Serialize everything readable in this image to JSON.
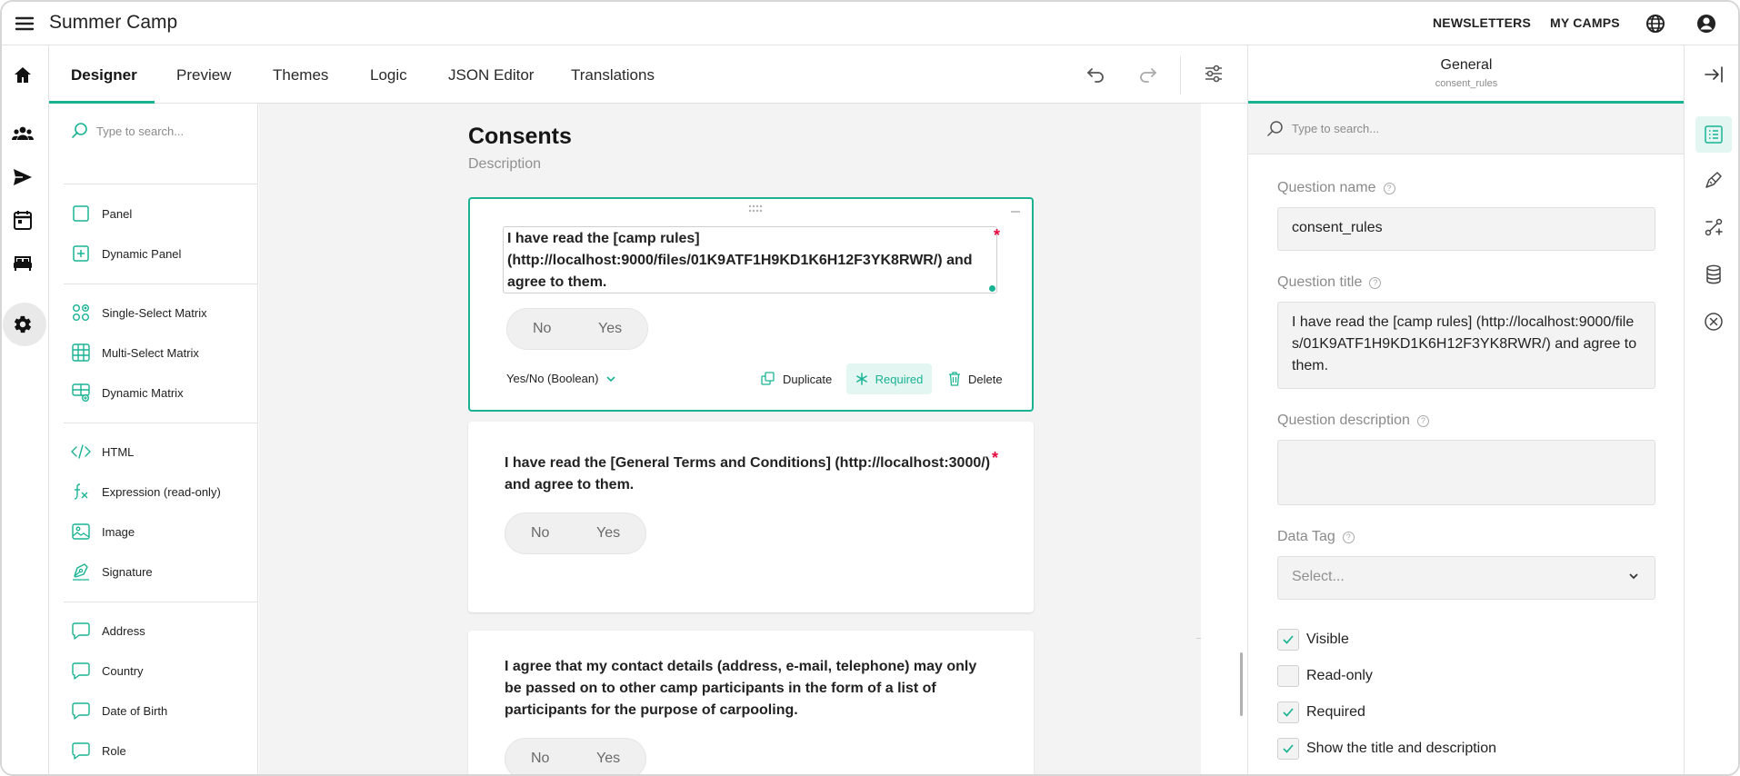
{
  "app": {
    "title": "Summer Camp",
    "links": [
      "NEWSLETTERS",
      "MY CAMPS"
    ],
    "icons": [
      "menu-icon",
      "globe-icon",
      "account-icon"
    ]
  },
  "rail": {
    "icons": [
      "home-icon",
      "people-icon",
      "send-icon",
      "calendar-icon",
      "bed-icon",
      "gear-icon"
    ],
    "selected": "gear-icon"
  },
  "tabs": {
    "items": [
      "Designer",
      "Preview",
      "Themes",
      "Logic",
      "JSON Editor",
      "Translations"
    ],
    "active": "Designer",
    "tools": [
      "undo-icon",
      "redo-icon",
      "settings-sliders-icon"
    ]
  },
  "toolbox": {
    "search_placeholder": "Type to search...",
    "items": [
      "Panel",
      "Dynamic Panel",
      "Single-Select Matrix",
      "Multi-Select Matrix",
      "Dynamic Matrix",
      "HTML",
      "Expression (read-only)",
      "Image",
      "Signature",
      "Address",
      "Country",
      "Date of Birth",
      "Role"
    ]
  },
  "survey": {
    "page_title": "Consents",
    "page_description": "Description",
    "questions": [
      {
        "title": "I have read the [camp rules] (http://localhost:9000/files/01K9ATF1H9KD1K6H12F3YK8RWR/) and agree to them.",
        "required_mark": "*",
        "no": "No",
        "yes": "Yes",
        "type_label": "Yes/No (Boolean)",
        "actions": [
          "Duplicate",
          "Required",
          "Delete"
        ]
      },
      {
        "title": "I have read the [General Terms and Conditions] (http://localhost:3000/) and agree to them.",
        "required_mark": "*",
        "no": "No",
        "yes": "Yes"
      },
      {
        "title": "I agree that my contact details (address, e-mail, telephone) may only be passed on to other camp participants in the form of a list of participants for the purpose of carpooling.",
        "no": "No",
        "yes": "Yes"
      }
    ]
  },
  "canvas_tools": [
    "copy-icon",
    "zoom-in-icon",
    "zoom-fit-icon",
    "zoom-out-icon",
    "collapse-icon",
    "drag-icon",
    "lock-icon"
  ],
  "properties": {
    "header_title": "General",
    "header_subtitle": "consent_rules",
    "search_placeholder": "Type to search...",
    "question_name_label": "Question name",
    "question_name_value": "consent_rules",
    "question_title_label": "Question title",
    "question_title_value": "I have read the [camp rules] (http://localhost:9000/files/01K9ATF1H9KD1K6H12F3YK8RWR/) and agree to them.",
    "question_description_label": "Question description",
    "question_description_value": "",
    "data_tag_label": "Data Tag",
    "data_tag_placeholder": "Select...",
    "checkboxes": [
      {
        "label": "Visible",
        "checked": true
      },
      {
        "label": "Read-only",
        "checked": false
      },
      {
        "label": "Required",
        "checked": true
      },
      {
        "label": "Show the title and description",
        "checked": true
      }
    ]
  },
  "right_rail": {
    "icons": [
      "collapse-panel-icon",
      "general-list-icon",
      "logic-brush-icon",
      "conditions-icon",
      "data-icon",
      "validation-icon"
    ],
    "selected": "general-list-icon"
  },
  "colors": {
    "accent": "#19b394",
    "required": "#e50a3e"
  }
}
